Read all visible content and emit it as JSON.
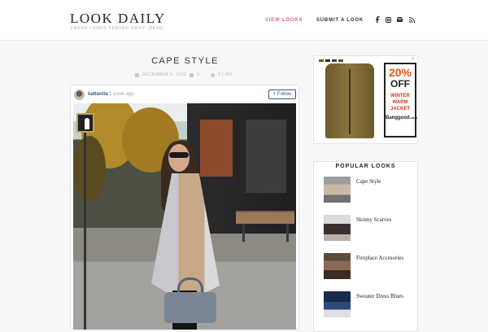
{
  "header": {
    "logo": "LOOK DAILY",
    "tagline": "FRESH LOOKS SERVED DAILY (BETA)",
    "nav": [
      {
        "label": "VIEW LOOKS",
        "active": true
      },
      {
        "label": "SUBMIT A LOOK",
        "active": false
      }
    ],
    "social_icons": [
      "facebook-icon",
      "instagram-icon",
      "mail-icon",
      "rss-icon"
    ],
    "accent_color": "#e0607a"
  },
  "post": {
    "title": "CAPE STYLE",
    "date": "DECEMBER 8, 2015",
    "comments": "0",
    "likes": "0 LIKE",
    "author": "kattanita",
    "ago": "1 week ago",
    "follow_label": "+ Follow"
  },
  "ad": {
    "percent": "20%",
    "off": "OFF",
    "line1": "WINTER",
    "line2": "WARM",
    "line3": "JACKET",
    "brand": "Banggood",
    "brand_suffix": ".com",
    "close": "×"
  },
  "sidebar": {
    "title": "POPULAR LOOKS",
    "items": [
      {
        "label": "Cape Style"
      },
      {
        "label": "Skinny Scarves"
      },
      {
        "label": "Fireplace Accesories"
      },
      {
        "label": "Sweater Dress Blues"
      }
    ]
  }
}
